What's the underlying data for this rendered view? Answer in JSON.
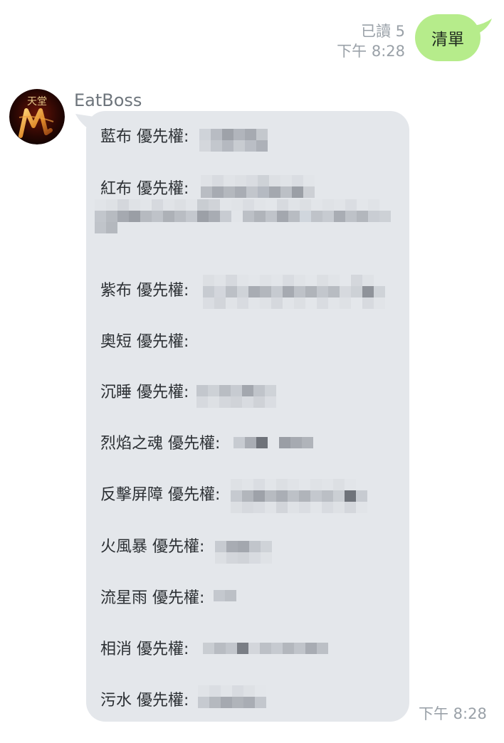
{
  "outgoing": {
    "read_label": "已讀 5",
    "time": "下午 8:28",
    "text": "清單"
  },
  "incoming": {
    "sender": "EatBoss",
    "avatar_icon": "lineage-m-avatar-icon",
    "time": "下午 8:28",
    "rows": [
      {
        "label": "藍布 優先權:"
      },
      {
        "label": "紅布 優先權:"
      },
      {
        "label": "紫布 優先權:"
      },
      {
        "label": "奧短 優先權:"
      },
      {
        "label": "沉睡 優先權:"
      },
      {
        "label": "烈焰之魂 優先權:"
      },
      {
        "label": "反擊屏障 優先權:"
      },
      {
        "label": "火風暴 優先權:"
      },
      {
        "label": "流星雨 優先權:"
      },
      {
        "label": "相消 優先權:"
      },
      {
        "label": "污水 優先權:"
      }
    ]
  },
  "colors": {
    "outgoing_bubble": "#b6ec8b",
    "incoming_bubble": "#e4e7eb",
    "meta_text": "#9aa1a8"
  }
}
